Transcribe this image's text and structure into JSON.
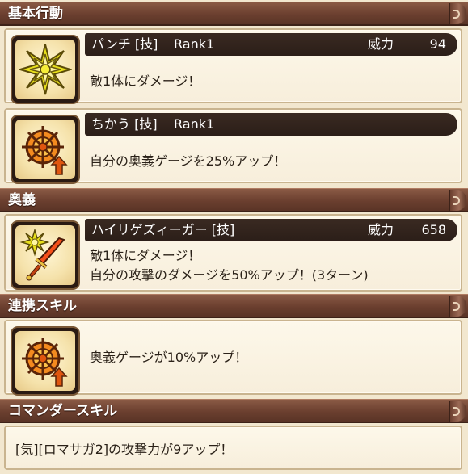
{
  "sections": {
    "basic": "基本行動",
    "ougi": "奥義",
    "renkei": "連携スキル",
    "commander": "コマンダースキル"
  },
  "skills": [
    {
      "name": "パンチ [技]",
      "rank": "Rank1",
      "power_label": "威力",
      "power": "94",
      "desc": [
        "敵1体にダメージ！"
      ],
      "icon": "punch-impact-icon"
    },
    {
      "name": "ちかう [技]",
      "rank": "Rank1",
      "desc": [
        "自分の奥義ゲージを25%アップ！"
      ],
      "icon": "gauge-up-icon"
    }
  ],
  "ougi": {
    "name": "ハイリゲズィーガー [技]",
    "power_label": "威力",
    "power": "658",
    "desc": [
      "敵1体にダメージ！",
      "自分の攻撃のダメージを50%アップ！(3ターン)"
    ],
    "icon": "sword-strike-icon"
  },
  "renkei": {
    "desc": "奥義ゲージが10%アップ！",
    "icon": "gauge-up-icon"
  },
  "commander": {
    "desc": "[気][ロマサガ2]の攻撃力が9アップ！"
  },
  "colors": {
    "header": "#6b3f2f",
    "title_bar": "#2b1e18",
    "card_bg": "#fbf4e3",
    "accent_yellow": "#e8e01a",
    "accent_orange": "#e0560f"
  }
}
